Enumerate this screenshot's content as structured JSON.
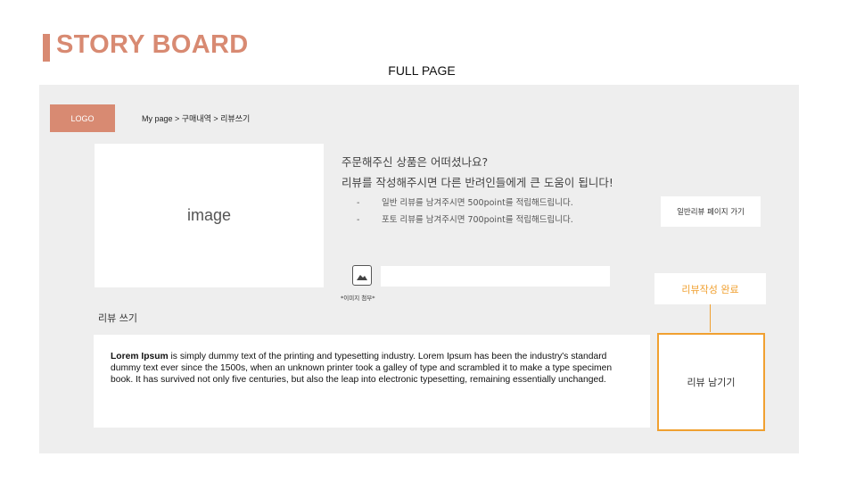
{
  "header": {
    "title": "STORY BOARD",
    "subtitle": "FULL PAGE"
  },
  "nav": {
    "logo": "LOGO",
    "breadcrumb": "My page >  구매내역 > 리뷰쓰기"
  },
  "product": {
    "image_label": "image"
  },
  "prompt": {
    "question": "주문해주신 상품은 어떠셨나요?",
    "encourage": "리뷰를 작성해주시면 다른 반려인들에게 큰 도움이 됩니다!",
    "bullets": [
      {
        "dash": "-",
        "text": "일반 리뷰를 남겨주시면 500point를 적립해드립니다."
      },
      {
        "dash": "-",
        "text": "포토 리뷰를 남겨주시면 700point를 적립해드립니다."
      }
    ]
  },
  "general_review_button": "일반리뷰 페이지 가기",
  "attach": {
    "label": "*이미지 첨부*",
    "field_value": ""
  },
  "done_button": "리뷰작성 완료",
  "review": {
    "label": "리뷰 쓰기",
    "bold_lead": "Lorem Ipsum",
    "body": " is simply dummy text of the printing and typesetting industry. Lorem Ipsum has been the industry's standard dummy text ever since the 1500s, when an unknown printer took a galley of type and scrambled it to make a type specimen book. It has survived not only five centuries, but also the leap into electronic typesetting, remaining essentially unchanged."
  },
  "submit_button": "리뷰 남기기",
  "colors": {
    "brand": "#d88a72",
    "accent": "#f0a030",
    "frame_bg": "#eeeeee"
  },
  "icons": {
    "attach": "image-icon"
  }
}
